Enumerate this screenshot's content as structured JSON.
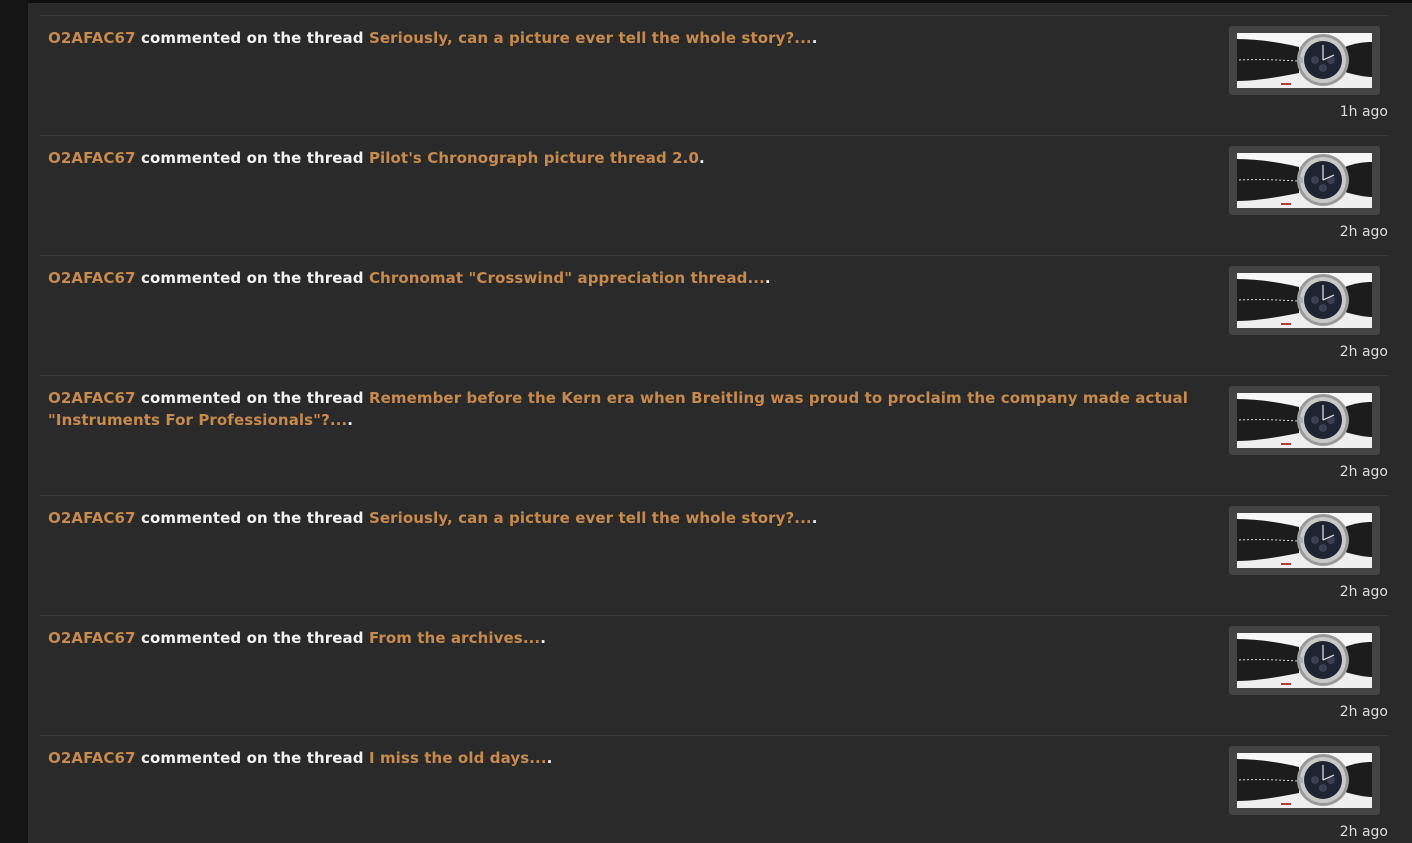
{
  "feed": {
    "items": [
      {
        "user": "O2AFAC67",
        "verb": "commented on the thread",
        "thread": "Seriously, can a picture ever tell the whole story?...",
        "end": ".",
        "time": "1h ago",
        "thumbnail": "watch-photo-icon"
      },
      {
        "user": "O2AFAC67",
        "verb": "commented on the thread",
        "thread": "Pilot's Chronograph picture thread 2.0",
        "end": ".",
        "time": "2h ago",
        "thumbnail": "watch-photo-icon"
      },
      {
        "user": "O2AFAC67",
        "verb": "commented on the thread",
        "thread": "Chronomat \"Crosswind\" appreciation thread...",
        "end": ".",
        "time": "2h ago",
        "thumbnail": "watch-photo-icon"
      },
      {
        "user": "O2AFAC67",
        "verb": "commented on the thread",
        "thread": "Remember before the Kern era when Breitling was proud to proclaim the company made actual \"Instruments For Professionals\"?...",
        "end": ".",
        "time": "2h ago",
        "thumbnail": "watch-photo-icon"
      },
      {
        "user": "O2AFAC67",
        "verb": "commented on the thread",
        "thread": "Seriously, can a picture ever tell the whole story?...",
        "end": ".",
        "time": "2h ago",
        "thumbnail": "watch-photo-icon"
      },
      {
        "user": "O2AFAC67",
        "verb": "commented on the thread",
        "thread": "From the archives...",
        "end": ".",
        "time": "2h ago",
        "thumbnail": "watch-photo-icon"
      },
      {
        "user": "O2AFAC67",
        "verb": "commented on the thread",
        "thread": "I miss the old days...",
        "end": ".",
        "time": "2h ago",
        "thumbnail": "watch-photo-icon"
      }
    ]
  },
  "colors": {
    "background": "#2a2a2a",
    "link": "#c58a4c",
    "text": "#f2f2f2",
    "divider": "#3b3b3b"
  }
}
